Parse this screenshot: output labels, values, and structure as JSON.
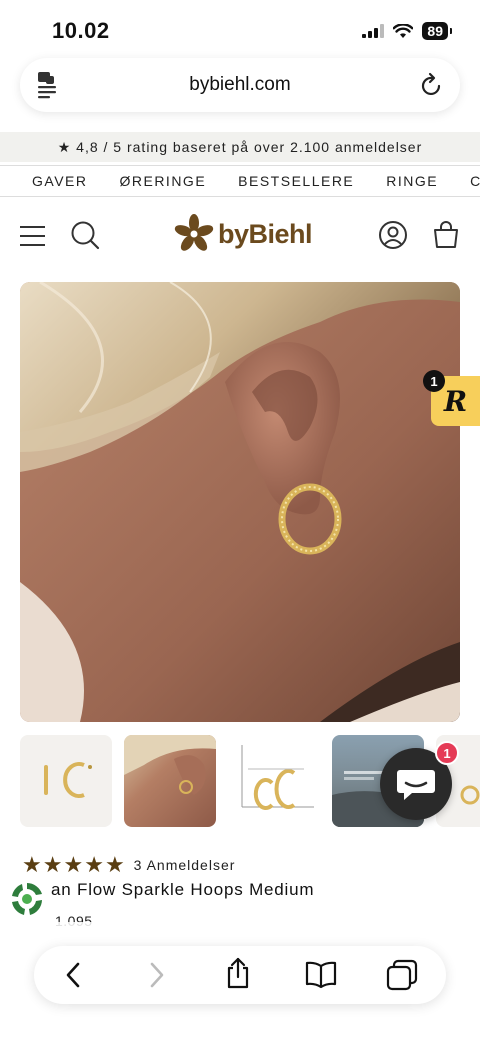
{
  "status": {
    "time": "10.02",
    "battery": "89"
  },
  "browser": {
    "url": "bybiehl.com"
  },
  "announcement": {
    "text": "★ 4,8 / 5 rating baseret på over 2.100 anmeldelser"
  },
  "nav": {
    "items": [
      "GAVER",
      "ØRERINGE",
      "BESTSELLERE",
      "RINGE",
      "CHAR"
    ]
  },
  "header": {
    "logo_text": "byBiehl"
  },
  "reviews_widget": {
    "badge": "1",
    "letter": "R"
  },
  "chat": {
    "badge": "1"
  },
  "product": {
    "rating_stars": 5,
    "review_count": "3 Anmeldelser",
    "title": "an Flow Sparkle Hoops Medium",
    "price": "1.095"
  },
  "colors": {
    "brand": "#6b4a1e",
    "star": "#5a3e12",
    "reviews_tab": "#f7cf5b",
    "chat_badge": "#e53b56"
  }
}
